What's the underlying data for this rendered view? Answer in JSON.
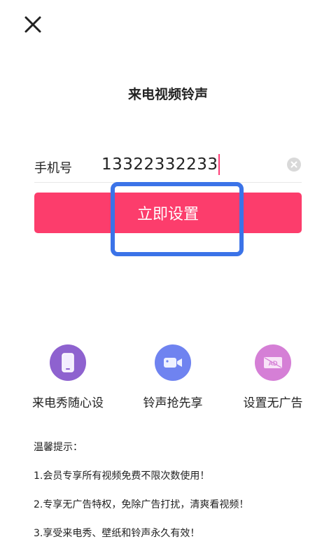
{
  "page": {
    "title": "来电视频铃声"
  },
  "form": {
    "phone_label": "手机号",
    "phone_value": "13322332233",
    "submit_label": "立即设置"
  },
  "features": [
    {
      "label": "来电秀随心设",
      "icon": "phone-icon",
      "color": "#8e62cf"
    },
    {
      "label": "铃声抢先享",
      "icon": "video-camera-icon",
      "color": "#6f83f0"
    },
    {
      "label": "设置无广告",
      "icon": "no-ad-icon",
      "color": "#d57fd6"
    }
  ],
  "tips": {
    "title": "温馨提示：",
    "lines": [
      "1.会员专享所有视频免费不限次数使用！",
      "2.专享无广告特权，免除广告打扰，清爽看视频！",
      "3.享受来电秀、壁纸和铃声永久有效！"
    ]
  },
  "colors": {
    "accent": "#fc3d6c",
    "highlight": "#3b73e8"
  }
}
